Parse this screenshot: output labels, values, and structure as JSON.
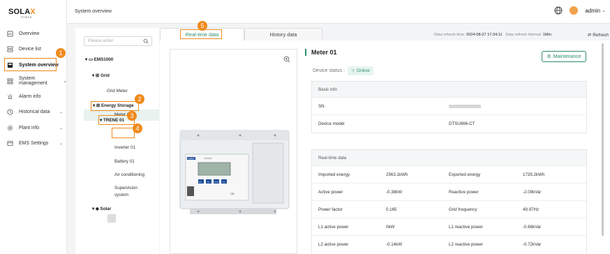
{
  "brand": {
    "logo_main": "SOLA",
    "logo_x": "X",
    "logo_sub": "POWER"
  },
  "sidebar": {
    "items": [
      {
        "label": "Overview",
        "icon": "dashboard-icon"
      },
      {
        "label": "Device list",
        "icon": "device-list-icon"
      },
      {
        "label": "System overview",
        "icon": "system-overview-icon"
      },
      {
        "label": "System management",
        "icon": "system-management-icon",
        "caret": "⌄"
      },
      {
        "label": "Alarm info",
        "icon": "alarm-icon"
      },
      {
        "label": "Historical data",
        "icon": "history-icon",
        "caret": "⌄"
      },
      {
        "label": "Plant info",
        "icon": "plant-icon",
        "caret": "⌄"
      },
      {
        "label": "EMS Settings",
        "icon": "ems-settings-icon",
        "caret": "⌄"
      }
    ]
  },
  "header": {
    "title": "System overview",
    "user": "admin",
    "user_caret": "⌄"
  },
  "tree": {
    "search_placeholder": "Please enter",
    "nodes": {
      "ems": "EMS1000",
      "grid": "Grid",
      "grid_meter": "Grid Meter",
      "energy_storage": "Energy Storage",
      "trene": "TRENE 01",
      "meter": "Meter 01",
      "inverter": "Inverter 01",
      "battery": "Battery 01",
      "air": "Air conditioning",
      "supervision1": "Supervision",
      "supervision2": "system",
      "solar": "Solar"
    },
    "expand_glyph": "▾"
  },
  "tabs": [
    {
      "label": "Real-time data"
    },
    {
      "label": "History data"
    }
  ],
  "refresh": {
    "time_label": "Data refresh time:",
    "time_value": "2024-08-27 17:34:11",
    "interval_label": "Data refresh interval:",
    "interval_value": "1Min",
    "button": "Refresh"
  },
  "device": {
    "name": "Meter 01",
    "status_label": "Device status :",
    "status_value": "Online",
    "maintenance_label": "Maintenance",
    "image_brand": "CHNT",
    "image_model_text": "DTSU666",
    "image_ce": "CE",
    "image_keys": [
      "ESC",
      "SET",
      "MODE",
      "ENT"
    ]
  },
  "basic_info": {
    "title": "Basic info",
    "rows": [
      {
        "label": "SN",
        "value": ""
      },
      {
        "label": "Device model",
        "value": "DTSU666-CT"
      }
    ]
  },
  "realtime": {
    "title": "Real-time data",
    "rows": [
      {
        "l1": "Imported energy",
        "v1": "2563.1kWh",
        "l2": "Exported energy",
        "v2": "1739.2kWh"
      },
      {
        "l1": "Active power",
        "v1": "-0.38kW",
        "l2": "Reactive power",
        "v2": "-2.09kVar"
      },
      {
        "l1": "Power factor",
        "v1": "0.165",
        "l2": "Grid frequency",
        "v2": "49.97Hz"
      },
      {
        "l1": "L1 active power",
        "v1": "0kW",
        "l2": "L1 reactive power",
        "v2": "-0.68kVar"
      },
      {
        "l1": "L2 active power",
        "v1": "-0.14kW",
        "l2": "L2 reactive power",
        "v2": "-0.72kVar"
      }
    ]
  },
  "annotations": [
    "1",
    "2",
    "3",
    "4",
    "5"
  ],
  "colors": {
    "accent": "#2e8b6d",
    "highlight": "#f08a1c",
    "bg": "#f3f4f6"
  }
}
